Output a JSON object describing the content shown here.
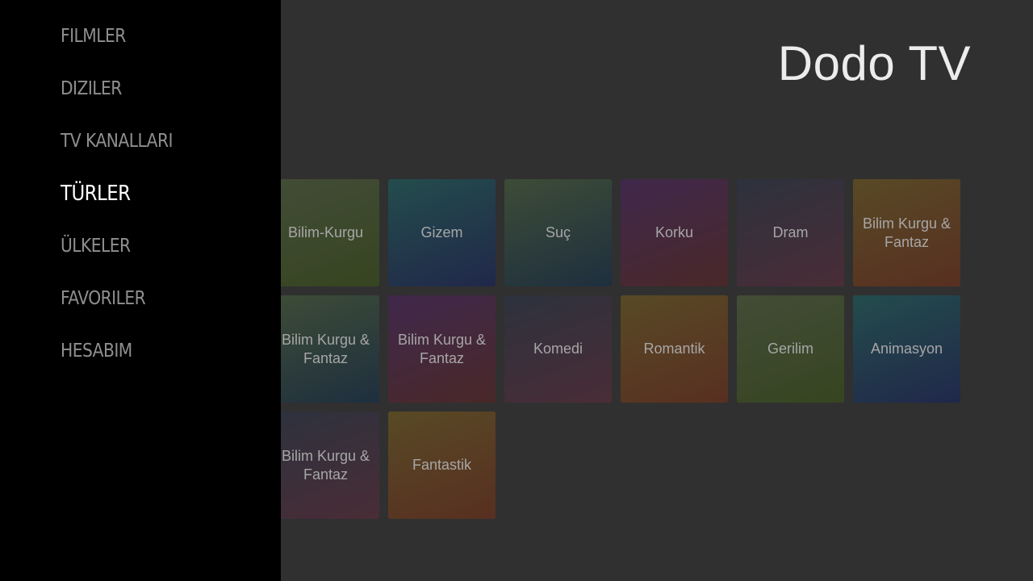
{
  "app": {
    "title": "Dodo TV"
  },
  "sidebar": {
    "items": [
      {
        "label": "FILMLER",
        "active": false
      },
      {
        "label": "DIZILER",
        "active": false
      },
      {
        "label": "TV KANALLARI",
        "active": false
      },
      {
        "label": "TÜRLER",
        "active": true
      },
      {
        "label": "ÜLKELER",
        "active": false
      },
      {
        "label": "FAVORILER",
        "active": false
      },
      {
        "label": "HESABIM",
        "active": false
      }
    ]
  },
  "genres": {
    "tiles": [
      {
        "label": "Bilim-Kurgu",
        "gradient": [
          "#5a7040",
          "#3f5f10"
        ]
      },
      {
        "label": "Gizem",
        "gradient": [
          "#157070",
          "#0f1f6a"
        ]
      },
      {
        "label": "Suç",
        "gradient": [
          "#4f7040",
          "#0a2f52"
        ]
      },
      {
        "label": "Korku",
        "gradient": [
          "#552070",
          "#6a1f20"
        ]
      },
      {
        "label": "Dram",
        "gradient": [
          "#2a3550",
          "#6a2a40"
        ]
      },
      {
        "label": "Bilim Kurgu & Fantaz",
        "gradient": [
          "#8a6a1a",
          "#8a2f10"
        ]
      },
      {
        "label": "Bilim Kurgu & Fantaz",
        "gradient": [
          "#4f7040",
          "#0a2f52"
        ]
      },
      {
        "label": "Bilim Kurgu & Fantaz",
        "gradient": [
          "#552070",
          "#6a1f20"
        ]
      },
      {
        "label": "Komedi",
        "gradient": [
          "#2a3550",
          "#6a2a40"
        ]
      },
      {
        "label": "Romantik",
        "gradient": [
          "#8a6a1a",
          "#8a2f10"
        ]
      },
      {
        "label": "Gerilim",
        "gradient": [
          "#5a7040",
          "#3f5f10"
        ]
      },
      {
        "label": "Animasyon",
        "gradient": [
          "#157070",
          "#0f1f6a"
        ]
      },
      {
        "label": "Bilim Kurgu & Fantaz",
        "gradient": [
          "#2a3550",
          "#6a2a40"
        ]
      },
      {
        "label": "Fantastik",
        "gradient": [
          "#8a6a1a",
          "#8a2f10"
        ]
      }
    ]
  }
}
